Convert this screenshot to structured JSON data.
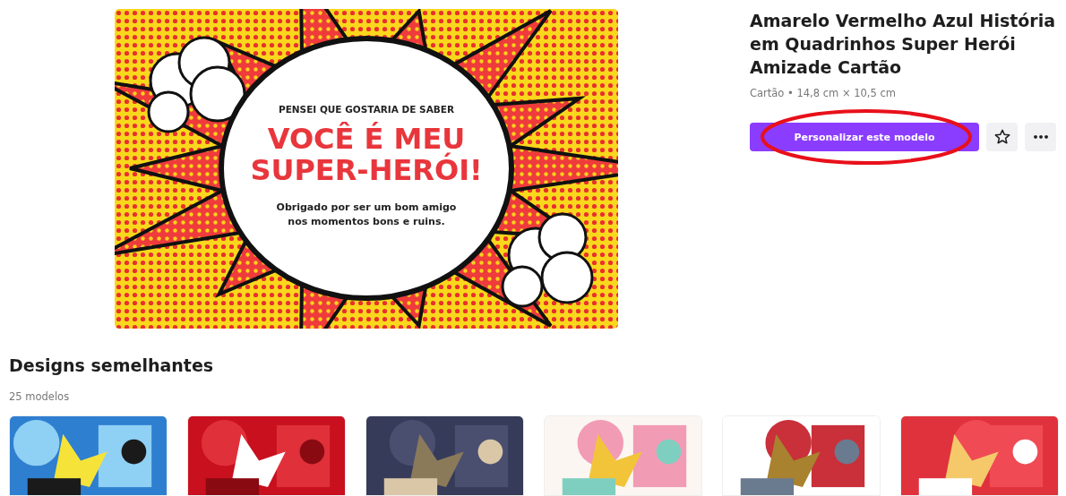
{
  "design": {
    "kicker": "PENSEI QUE GOSTARIA DE SABER",
    "headline": [
      "VOCÊ É MEU",
      "SUPER-HERÓI!"
    ],
    "message": [
      "Obrigado por ser um bom amigo",
      "nos momentos bons e ruins."
    ]
  },
  "details": {
    "title": "Amarelo Vermelho Azul História em Quadrinhos Super Herói Amizade Cartão",
    "meta": "Cartão • 14,8 cm × 10,5 cm",
    "primary_button": "Personalizar este modelo",
    "favorite": {
      "selected": false
    },
    "more_button": "•••"
  },
  "similar": {
    "heading": "Designs semelhantes",
    "count": "25 modelos"
  }
}
